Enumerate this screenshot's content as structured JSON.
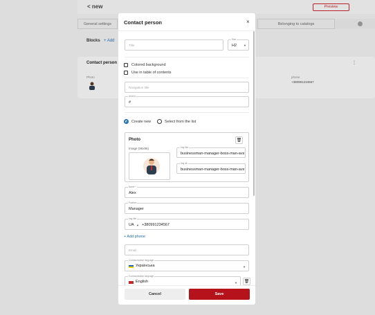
{
  "bg": {
    "back_label": "new",
    "preview_label": "Preview",
    "tabs": [
      "General settings",
      "Belonging to catalogs"
    ],
    "blocks_label": "Blocks",
    "add_block_label": "+ Add",
    "card_title": "Contact person",
    "photo_label": "Photo",
    "phone_label": "phone",
    "phone_value": "+380991234567"
  },
  "modal": {
    "title": "Contact person",
    "close": "×",
    "title_field": {
      "placeholder": "Title"
    },
    "size": {
      "label": "Size",
      "value": "H2"
    },
    "colored_bg": "Colored background",
    "use_toc": "Use in table of contents",
    "nav_title": {
      "placeholder": "Navigation title"
    },
    "anchor": {
      "label": "Anchor",
      "value": "#"
    },
    "radio_create": "Create new",
    "radio_select": "Select from the list",
    "photo": {
      "title": "Photo",
      "image_label": "Image (96x96)",
      "img_title_label": "Img title",
      "img_title_value": "businessman-manager-boss-man-avatar",
      "img_alt_label": "Img alt",
      "img_alt_value": "businessman-manager-boss-man-avatar"
    },
    "name": {
      "label": "Name *",
      "value": "Alex"
    },
    "position": {
      "label": "Position",
      "value": "Manager"
    },
    "phone": {
      "label": "Img title",
      "country": "UA",
      "value": "+380991234567"
    },
    "add_phone": "+ Add phone",
    "email": {
      "placeholder": "Email"
    },
    "comm_lang_1": {
      "label": "Communication language",
      "value": "Українська"
    },
    "comm_lang_2": {
      "label": "Communication language",
      "value": "English"
    },
    "cancel": "Cancel",
    "save": "Save"
  },
  "colors": {
    "accent": "#b5121b",
    "link": "#1f6fb5"
  },
  "icons": [
    "close-icon",
    "trash-icon",
    "chevron-down-icon",
    "radio-icon",
    "checkbox-icon",
    "flag-ua-icon",
    "flag-uk-icon"
  ]
}
